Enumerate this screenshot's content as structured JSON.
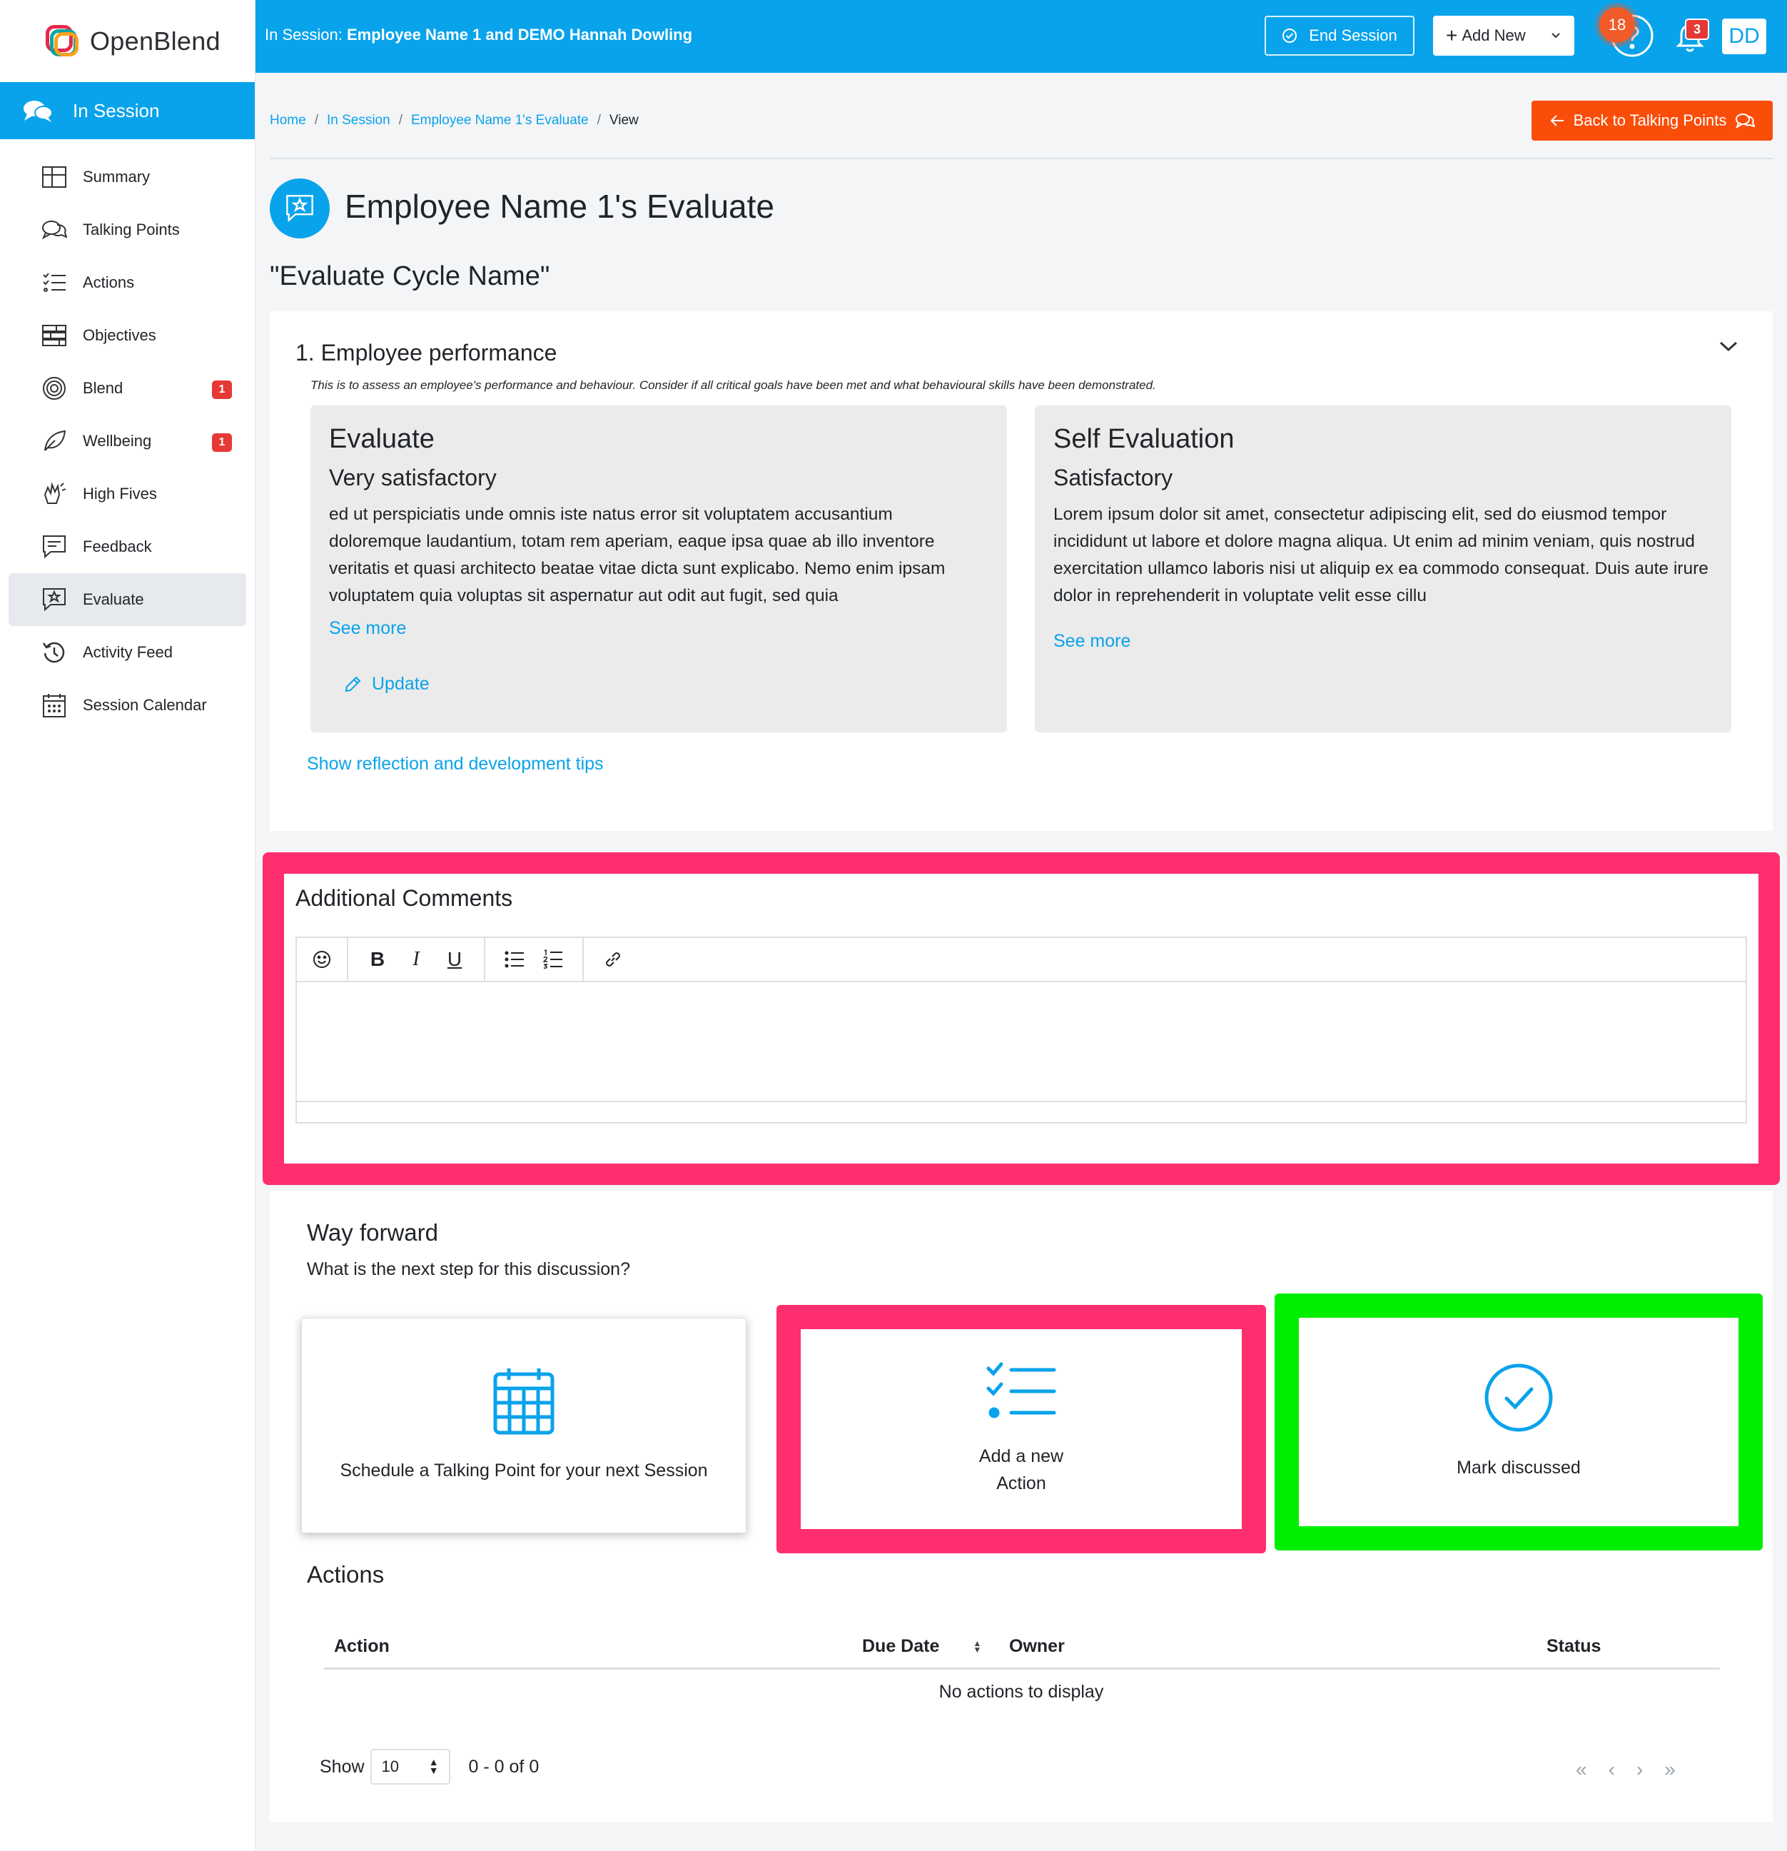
{
  "brand": {
    "name_part1": "Open",
    "name_part2": "Blend"
  },
  "sidebar": {
    "header": "In Session",
    "items": [
      {
        "label": "Summary",
        "icon": "grid-icon",
        "badge": ""
      },
      {
        "label": "Talking Points",
        "icon": "chat-bubbles-icon",
        "badge": ""
      },
      {
        "label": "Actions",
        "icon": "checklist-icon",
        "badge": ""
      },
      {
        "label": "Objectives",
        "icon": "layers-icon",
        "badge": ""
      },
      {
        "label": "Blend",
        "icon": "target-icon",
        "badge": "1"
      },
      {
        "label": "Wellbeing",
        "icon": "leaf-icon",
        "badge": "1"
      },
      {
        "label": "High Fives",
        "icon": "clap-icon",
        "badge": ""
      },
      {
        "label": "Feedback",
        "icon": "message-square-icon",
        "badge": ""
      },
      {
        "label": "Evaluate",
        "icon": "star-message-icon",
        "badge": ""
      },
      {
        "label": "Activity Feed",
        "icon": "history-icon",
        "badge": ""
      },
      {
        "label": "Session Calendar",
        "icon": "calendar-icon",
        "badge": ""
      }
    ],
    "active": "Evaluate"
  },
  "topbar": {
    "session_prefix": "In Session:",
    "session_names": "Employee Name 1 and DEMO Hannah Dowling",
    "end_session": "End Session",
    "add_new": "Add New",
    "help_badge": "18",
    "notif_badge": "3",
    "avatar": "DD"
  },
  "breadcrumb": [
    "Home",
    "In Session",
    "Employee Name 1's Evaluate",
    "View"
  ],
  "back_button": "Back to Talking Points",
  "page": {
    "title": "Employee Name 1's Evaluate",
    "cycle": "\"Evaluate Cycle Name\""
  },
  "question": {
    "title": "1. Employee performance",
    "description": "This is to assess an employee's performance and behaviour. Consider if all critical goals have been met and what behavioural skills have been demonstrated.",
    "evaluate": {
      "heading": "Evaluate",
      "rating": "Very satisfactory",
      "text": "ed ut perspiciatis unde omnis iste natus error sit voluptatem accusantium doloremque laudantium, totam rem aperiam, eaque ipsa quae ab illo inventore veritatis et quasi architecto beatae vitae dicta sunt explicabo. Nemo enim ipsam voluptatem quia voluptas sit aspernatur aut odit aut fugit, sed quia",
      "see_more": "See more",
      "update": "Update"
    },
    "self": {
      "heading": "Self Evaluation",
      "rating": "Satisfactory",
      "text": "Lorem ipsum dolor sit amet, consectetur adipiscing elit, sed do eiusmod tempor incididunt ut labore et dolore magna aliqua. Ut enim ad minim veniam, quis nostrud exercitation ullamco laboris nisi ut aliquip ex ea commodo consequat. Duis aute irure dolor in reprehenderit in voluptate velit esse cillu",
      "see_more": "See more"
    },
    "tips_link": "Show reflection and development tips"
  },
  "comments": {
    "heading": "Additional Comments",
    "toolbar": {
      "emoji": "☺",
      "bold": "B",
      "italic": "I",
      "underline": "U"
    },
    "value": ""
  },
  "way_forward": {
    "heading": "Way forward",
    "subheading": "What is the next step for this discussion?",
    "options": [
      {
        "label": "Schedule a Talking Point for your next Session",
        "icon": "calendar-icon"
      },
      {
        "label_line1": "Add a new",
        "label_line2": "Action",
        "icon": "checklist-icon"
      },
      {
        "label": "Mark discussed",
        "icon": "check-circle-icon"
      }
    ]
  },
  "actions_table": {
    "heading": "Actions",
    "columns": [
      "Action",
      "Due Date",
      "Owner",
      "Status"
    ],
    "empty_text": "No actions to display",
    "show_label": "Show",
    "page_size": "10",
    "range": "0 - 0 of 0"
  },
  "colors": {
    "primary": "#09a3eb",
    "back_button": "#fa4d09",
    "badge": "#e53935",
    "highlight_pink": "#ff2e6e",
    "highlight_green": "#00ee00"
  }
}
